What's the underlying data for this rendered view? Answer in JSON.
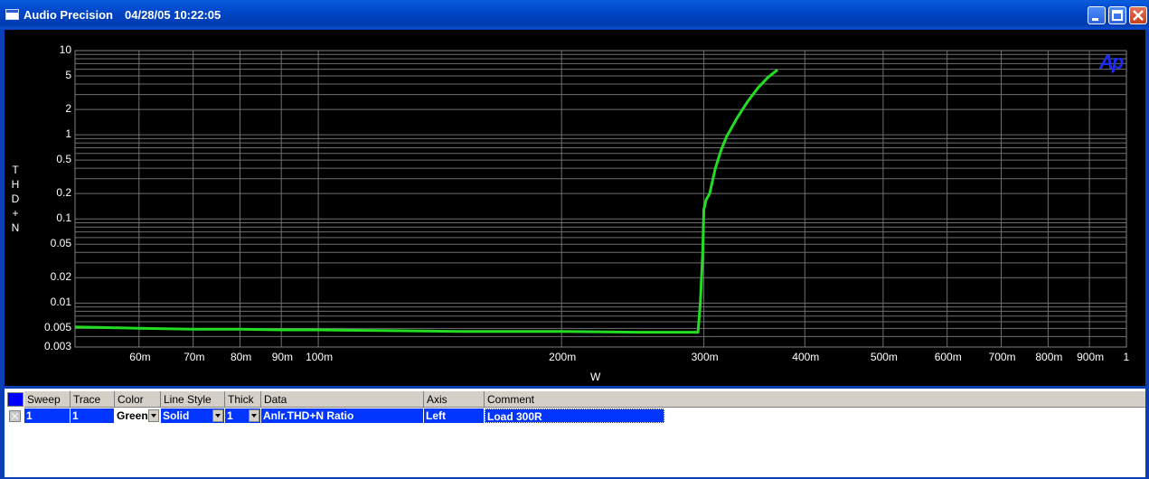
{
  "window": {
    "app_title": "Audio Precision",
    "timestamp": "04/28/05 10:22:05",
    "buttons": [
      "minimize",
      "maximize",
      "close"
    ]
  },
  "plot": {
    "y_axis_label": "THD+N",
    "x_axis_label": "W",
    "logo": "Ap",
    "y_ticks": [
      "10",
      "5",
      "2",
      "1",
      "0.5",
      "0.2",
      "0.1",
      "0.05",
      "0.02",
      "0.01",
      "0.005",
      "0.003"
    ],
    "x_ticks": [
      "60m",
      "70m",
      "80m",
      "90m",
      "100m",
      "200m",
      "300m",
      "400m",
      "500m",
      "600m",
      "700m",
      "800m",
      "900m",
      "1"
    ]
  },
  "chart_data": {
    "type": "line",
    "xscale": "log",
    "yscale": "log",
    "xlabel": "W",
    "ylabel": "THD+N",
    "xlim": [
      0.05,
      1.0
    ],
    "ylim": [
      0.003,
      10
    ],
    "grid": true,
    "series": [
      {
        "color": "#22dd22",
        "x": [
          0.05,
          0.055,
          0.06,
          0.07,
          0.08,
          0.09,
          0.1,
          0.12,
          0.15,
          0.2,
          0.25,
          0.295,
          0.297,
          0.299,
          0.3,
          0.302,
          0.305,
          0.31,
          0.315,
          0.32,
          0.33,
          0.34,
          0.35,
          0.36,
          0.37
        ],
        "y": [
          0.0052,
          0.0051,
          0.005,
          0.0049,
          0.0049,
          0.0048,
          0.0048,
          0.0047,
          0.0046,
          0.0046,
          0.0045,
          0.0045,
          0.01,
          0.04,
          0.13,
          0.17,
          0.2,
          0.4,
          0.65,
          0.95,
          1.6,
          2.5,
          3.6,
          4.8,
          5.9
        ]
      }
    ]
  },
  "table": {
    "headers": [
      "Sweep",
      "Trace",
      "Color",
      "Line Style",
      "Thick",
      "Data",
      "Axis",
      "Comment"
    ],
    "row": {
      "sweep": "1",
      "trace": "1",
      "color": "Green",
      "line_style": "Solid",
      "thick": "1",
      "data": "Anlr.THD+N Ratio",
      "axis": "Left",
      "comment": "Load 300R"
    }
  }
}
